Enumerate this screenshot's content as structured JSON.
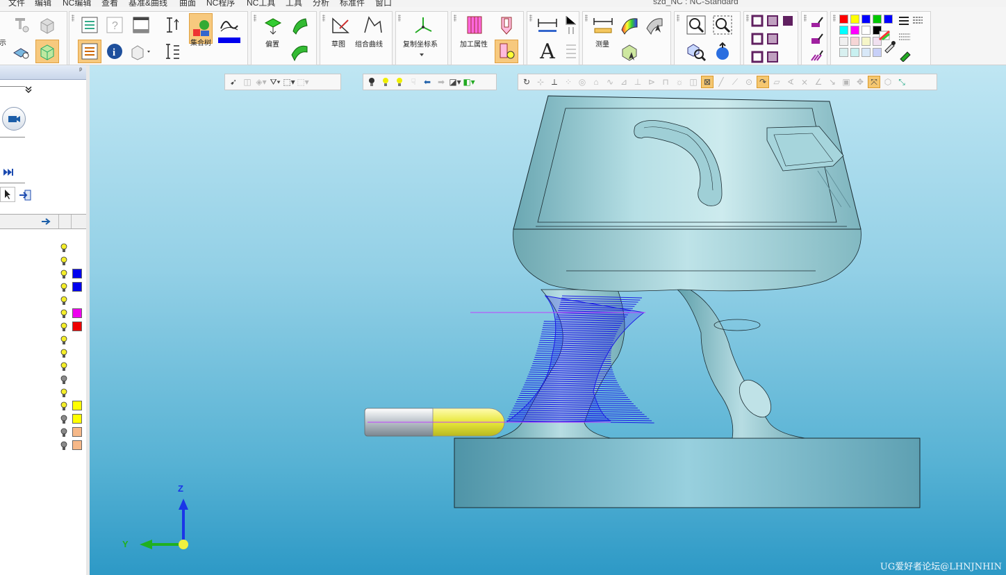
{
  "window": {
    "title": "szd_NC : NC-Standard"
  },
  "menu": [
    {
      "label": "文件"
    },
    {
      "label": "编辑"
    },
    {
      "label": "NC编辑"
    },
    {
      "label": "查看"
    },
    {
      "label": "基准&曲线"
    },
    {
      "label": "曲面"
    },
    {
      "label": "NC程序"
    },
    {
      "label": "NC工具"
    },
    {
      "label": "工具"
    },
    {
      "label": "分析"
    },
    {
      "label": "标准件"
    },
    {
      "label": "窗口"
    }
  ],
  "ribbon": {
    "partial_left_label": "示",
    "set_tree_label": "集合树",
    "offset_label": "偏置",
    "sketch_label": "草图",
    "combined_curve_label": "组合曲线",
    "copy_csys_label": "复制坐标系",
    "machining_attr_label": "加工属性",
    "measure_label": "测量",
    "text_glyph": "A"
  },
  "palette": {
    "row1": [
      "#ff0000",
      "#ffff00",
      "#0000ff",
      "#00c800",
      "#0000ff"
    ],
    "row2": [
      "#00ffff",
      "#ff00ff",
      "#ffffff",
      "#000000"
    ],
    "row3": [
      "#f0f0f0",
      "#f6d6d6",
      "#f6f6c8",
      "#f0e0f0"
    ],
    "row4": [
      "#d8f0f0",
      "#c8f0f0",
      "#d8e8f8",
      "#c8d0f8"
    ]
  },
  "left_panel": {
    "pin_glyph": "ᵖ",
    "layers": [
      {
        "bulb": "on",
        "color": ""
      },
      {
        "bulb": "on",
        "color": ""
      },
      {
        "bulb": "on",
        "color": "#0000ee"
      },
      {
        "bulb": "on",
        "color": "#0000ee"
      },
      {
        "bulb": "on",
        "color": ""
      },
      {
        "bulb": "on",
        "color": "#ee00ee"
      },
      {
        "bulb": "on",
        "color": "#ee0000"
      },
      {
        "bulb": "on",
        "color": ""
      },
      {
        "bulb": "on",
        "color": ""
      },
      {
        "bulb": "on",
        "color": ""
      },
      {
        "bulb": "off",
        "color": ""
      },
      {
        "bulb": "on",
        "color": ""
      },
      {
        "bulb": "on",
        "color": "#ffff00"
      },
      {
        "bulb": "off",
        "color": "#ffff00"
      },
      {
        "bulb": "off",
        "color": "#f6b888"
      },
      {
        "bulb": "off",
        "color": "#f6b888"
      }
    ]
  },
  "viewport": {
    "axis_z": "Z",
    "axis_y": "Y",
    "watermark": "UG爱好者论坛@LHNJNHIN",
    "colors": {
      "part": "#9fcfd6",
      "toolpath": "#1a1ae6",
      "tool_tip": "#e8e83a"
    }
  }
}
